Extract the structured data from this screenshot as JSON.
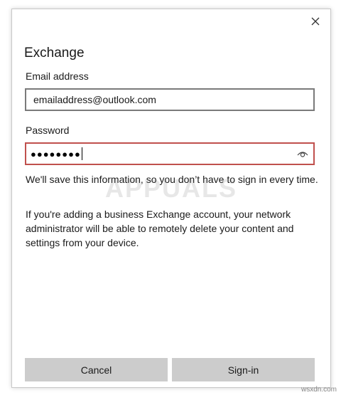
{
  "dialog": {
    "title": "Exchange",
    "close_icon": "close-icon"
  },
  "form": {
    "email_label": "Email address",
    "email_value": "emailaddress@outlook.com",
    "password_label": "Password",
    "password_masked": "●●●●●●●●",
    "reveal_icon": "eye-icon"
  },
  "info": {
    "paragraph_1": "We'll save this information, so you don’t have to sign in every time.",
    "paragraph_2": "If you're adding a business Exchange account, your network administrator will be able to remotely delete your content and settings from your device."
  },
  "buttons": {
    "cancel_label": "Cancel",
    "signin_label": "Sign-in"
  },
  "watermark": {
    "text": "APPUALS",
    "site": "wsxdn.com"
  },
  "colors": {
    "button_bg": "#cccccc",
    "input_border": "#7a7a7a",
    "focus_border": "#c0504d"
  }
}
